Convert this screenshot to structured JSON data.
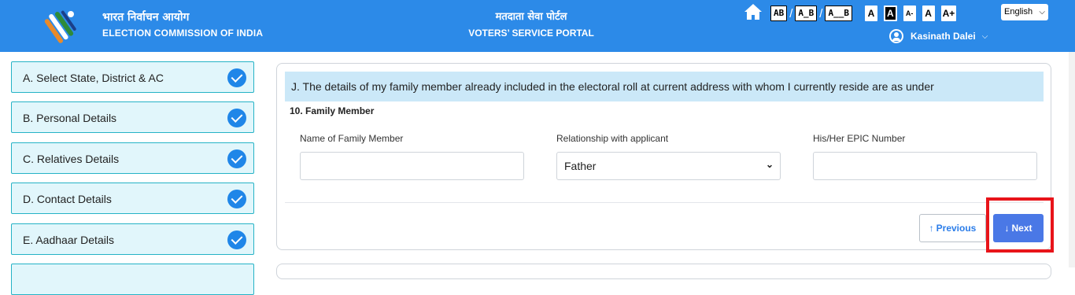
{
  "header": {
    "org_hindi": "भारत निर्वाचन आयोग",
    "org_english": "ELECTION COMMISSION OF INDIA",
    "portal_hindi": "मतदाता सेवा पोर्टल",
    "portal_english": "VOTERS’ SERVICE PORTAL",
    "spacing_buttons": [
      "AB",
      "A_B",
      "A__B"
    ],
    "font_buttons": [
      "A",
      "A",
      "A-",
      "A",
      "A+"
    ],
    "language": "English",
    "user_name": "Kasinath Dalei",
    "colors": {
      "header_bg": "#2c8ae8"
    }
  },
  "sidebar": {
    "steps": [
      {
        "label": "A. Select State, District & AC",
        "status": "complete"
      },
      {
        "label": "B. Personal Details",
        "status": "complete"
      },
      {
        "label": "C. Relatives Details",
        "status": "complete"
      },
      {
        "label": "D. Contact Details",
        "status": "complete"
      },
      {
        "label": "E. Aadhaar Details",
        "status": "complete"
      }
    ]
  },
  "main": {
    "notice": "J. The details of my family member already included in the electoral roll at current address with whom I currently reside are as under",
    "section_title": "10. Family Member",
    "fields": {
      "name_label": "Name of Family Member",
      "name_value": "",
      "relationship_label": "Relationship with applicant",
      "relationship_value": "Father",
      "epic_label": "His/Her EPIC Number",
      "epic_value": ""
    },
    "buttons": {
      "previous": "Previous",
      "next": "Next"
    }
  },
  "icons": [
    "home-icon",
    "user-icon",
    "check-icon",
    "arrow-up-icon",
    "arrow-down-icon",
    "chevron-down-icon"
  ]
}
